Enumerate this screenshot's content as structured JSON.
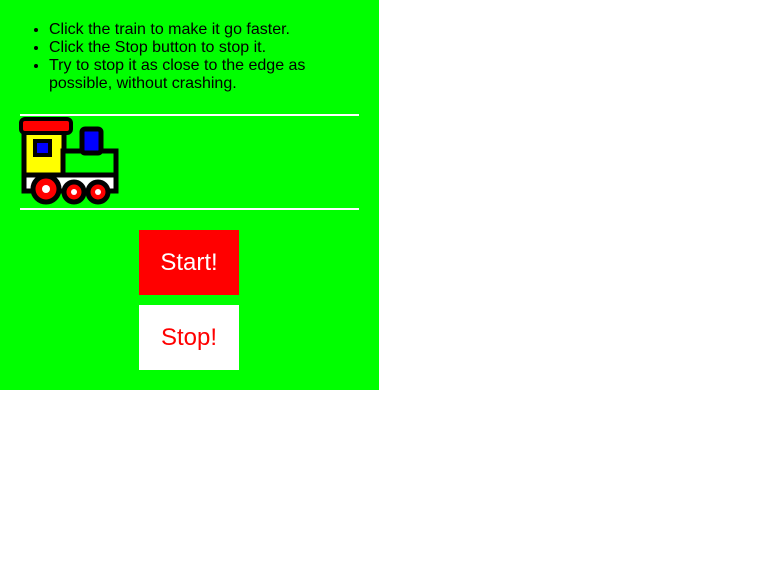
{
  "instructions": [
    "Click the train to make it go faster.",
    "Click the Stop button to stop it.",
    "Try to stop it as close to the edge as possible, without crashing."
  ],
  "train": {
    "icon": "train-icon"
  },
  "buttons": {
    "start_label": "Start!",
    "stop_label": "Stop!"
  },
  "colors": {
    "panel_background": "#00ff00",
    "start_button": "#ff0000",
    "stop_button": "#ffffff",
    "track_line": "#ffffff"
  }
}
